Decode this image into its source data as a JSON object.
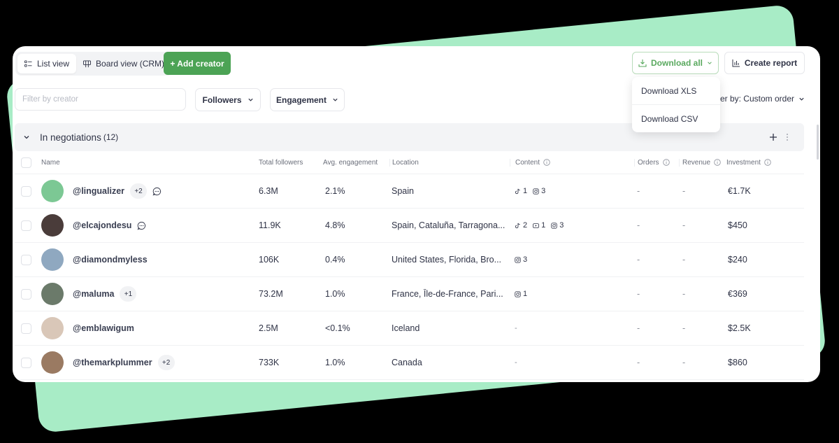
{
  "toolbar": {
    "view_toggle": [
      {
        "label": "List view",
        "icon": "list-icon",
        "active": true
      },
      {
        "label": "Board view (CRM)",
        "icon": "board-icon",
        "active": false
      }
    ],
    "add_creator_label": "+ Add creator",
    "download_all_label": "Download all",
    "create_report_label": "Create report"
  },
  "download_menu": {
    "items": [
      "Download XLS",
      "Download CSV"
    ]
  },
  "filters": {
    "search_placeholder": "Filter by creator",
    "search_value": "",
    "followers_label": "Followers",
    "engagement_label": "Engagement",
    "order_by_label": "Order by: Custom order"
  },
  "group": {
    "title": "In negotiations",
    "count": "(12)"
  },
  "table": {
    "columns": {
      "name": "Name",
      "followers": "Total followers",
      "engagement": "Avg. engagement",
      "location": "Location",
      "content": "Content",
      "orders": "Orders",
      "revenue": "Revenue",
      "investment": "Investment"
    },
    "rows": [
      {
        "handle": "@lingualizer",
        "badge": "+2",
        "chat": true,
        "avatar_color": "#7cc894",
        "followers": "6.3M",
        "engagement": "2.1%",
        "location": "Spain",
        "content": [
          {
            "icon": "tiktok-icon",
            "count": "1"
          },
          {
            "icon": "instagram-icon",
            "count": "3"
          }
        ],
        "orders": "-",
        "revenue": "-",
        "investment": "€1.7K"
      },
      {
        "handle": "@elcajondesu",
        "badge": "",
        "chat": true,
        "avatar_color": "#4a3c3a",
        "followers": "11.9K",
        "engagement": "4.8%",
        "location": "Spain, Cataluña, Tarragona...",
        "content": [
          {
            "icon": "tiktok-icon",
            "count": "2"
          },
          {
            "icon": "youtube-icon",
            "count": "1"
          },
          {
            "icon": "instagram-icon",
            "count": "3"
          }
        ],
        "orders": "-",
        "revenue": "-",
        "investment": "$450"
      },
      {
        "handle": "@diamondmyless",
        "badge": "",
        "chat": false,
        "avatar_color": "#8fa8c0",
        "followers": "106K",
        "engagement": "0.4%",
        "location": "United States, Florida, Bro...",
        "content": [
          {
            "icon": "instagram-icon",
            "count": "3"
          }
        ],
        "orders": "-",
        "revenue": "-",
        "investment": "$240"
      },
      {
        "handle": "@maluma",
        "badge": "+1",
        "chat": false,
        "avatar_color": "#6b7a6a",
        "followers": "73.2M",
        "engagement": "1.0%",
        "location": "France, Île-de-France, Pari...",
        "content": [
          {
            "icon": "instagram-icon",
            "count": "1"
          }
        ],
        "orders": "-",
        "revenue": "-",
        "investment": "€369"
      },
      {
        "handle": "@emblawigum",
        "badge": "",
        "chat": false,
        "avatar_color": "#d9c7b8",
        "followers": "2.5M",
        "engagement": "<0.1%",
        "location": "Iceland",
        "content": [],
        "content_empty": "-",
        "orders": "-",
        "revenue": "-",
        "investment": "$2.5K"
      },
      {
        "handle": "@themarkplummer",
        "badge": "+2",
        "chat": false,
        "avatar_color": "#9a7a62",
        "followers": "733K",
        "engagement": "1.0%",
        "location": "Canada",
        "content": [],
        "content_empty": "-",
        "orders": "-",
        "revenue": "-",
        "investment": "$860"
      }
    ]
  },
  "colors": {
    "accent_green": "#4ca355",
    "background_green": "#a8ecc6"
  }
}
